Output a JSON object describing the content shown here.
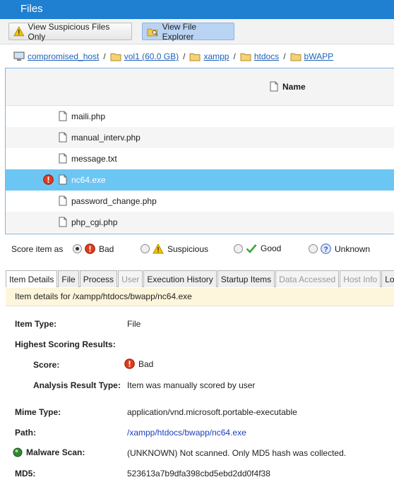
{
  "window": {
    "title": "Files"
  },
  "toolbar": {
    "suspicious_label": "View Suspicious Files Only",
    "explorer_label": "View File Explorer"
  },
  "breadcrumb": [
    {
      "label": "compromised_host"
    },
    {
      "label": "vol1 (60.0 GB)"
    },
    {
      "label": "xampp"
    },
    {
      "label": "htdocs"
    },
    {
      "label": "bWAPP"
    }
  ],
  "filelist": {
    "column_name": "Name",
    "rows": [
      {
        "name": "maili.php"
      },
      {
        "name": "manual_interv.php"
      },
      {
        "name": "message.txt"
      },
      {
        "name": "nc64.exe",
        "selected": true,
        "flag": "bad"
      },
      {
        "name": "password_change.php"
      },
      {
        "name": "php_cgi.php"
      }
    ]
  },
  "score": {
    "prefix": "Score item as",
    "options": [
      {
        "label": "Bad",
        "checked": true
      },
      {
        "label": "Suspicious",
        "checked": false
      },
      {
        "label": "Good",
        "checked": false
      },
      {
        "label": "Unknown",
        "checked": false
      }
    ]
  },
  "tabs": [
    {
      "label": "Item Details",
      "active": true,
      "enabled": true
    },
    {
      "label": "File",
      "active": false,
      "enabled": true
    },
    {
      "label": "Process",
      "active": false,
      "enabled": true
    },
    {
      "label": "User",
      "active": false,
      "enabled": false
    },
    {
      "label": "Execution History",
      "active": false,
      "enabled": true
    },
    {
      "label": "Startup Items",
      "active": false,
      "enabled": true
    },
    {
      "label": "Data Accessed",
      "active": false,
      "enabled": false
    },
    {
      "label": "Host Info",
      "active": false,
      "enabled": false
    },
    {
      "label": "Lo",
      "active": false,
      "enabled": true
    }
  ],
  "details": {
    "header": "Item details for /xampp/htdocs/bwapp/nc64.exe",
    "item_type_label": "Item Type:",
    "item_type_value": "File",
    "highest_label": "Highest Scoring Results:",
    "score_label": "Score:",
    "score_value": "Bad",
    "analysis_label": "Analysis Result Type:",
    "analysis_value": "Item was manually scored by user",
    "mime_label": "Mime Type:",
    "mime_value": "application/vnd.microsoft.portable-executable",
    "path_label": "Path:",
    "path_value": "/xampp/htdocs/bwapp/nc64.exe",
    "malware_label": "Malware Scan:",
    "malware_value": "(UNKNOWN) Not scanned. Only MD5 hash was collected.",
    "md5_label": "MD5:",
    "md5_value": "523613a7b9dfa398cbd5ebd2dd0f4f38"
  },
  "colors": {
    "titlebar": "#1f7fd1",
    "selected_row": "#6cc6f3",
    "bad": "#e03a1e",
    "link": "#1c62b8",
    "detail_header_bg": "#fdf6dc"
  }
}
